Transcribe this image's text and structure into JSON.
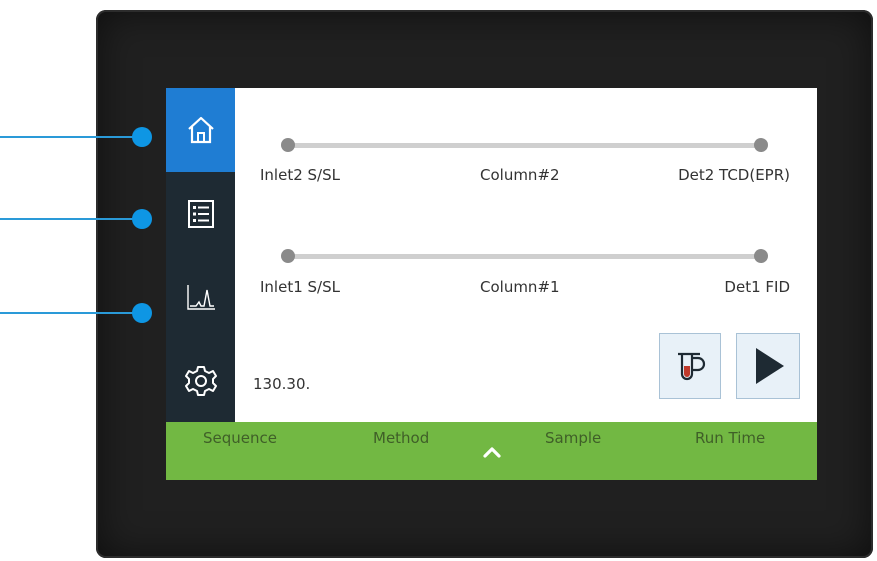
{
  "colors": {
    "bezel": "#202020",
    "sidebar": "#1e2a33",
    "active_nav": "#1f7dd3",
    "bottom_bar": "#72b843",
    "callout": "#0e96e4"
  },
  "sidebar": {
    "items": [
      {
        "name": "home",
        "icon": "home-icon",
        "active": true
      },
      {
        "name": "list",
        "icon": "list-icon",
        "active": false
      },
      {
        "name": "chromatogram",
        "icon": "chromatogram-icon",
        "active": false
      },
      {
        "name": "settings",
        "icon": "gear-icon",
        "active": false
      }
    ]
  },
  "flow_paths": [
    {
      "inlet": "Inlet2 S/SL",
      "column": "Column#2",
      "detector": "Det2 TCD(EPR)"
    },
    {
      "inlet": "Inlet1 S/SL",
      "column": "Column#1",
      "detector": "Det1 FID"
    }
  ],
  "firmware_text": "130.30.",
  "actions": {
    "prep_run_icon": "prep-run-icon",
    "start_icon": "play-icon"
  },
  "bottom_bar": {
    "tabs": [
      "Sequence",
      "Method",
      "Sample",
      "Run Time"
    ],
    "expand_icon": "chevron-up-icon"
  }
}
